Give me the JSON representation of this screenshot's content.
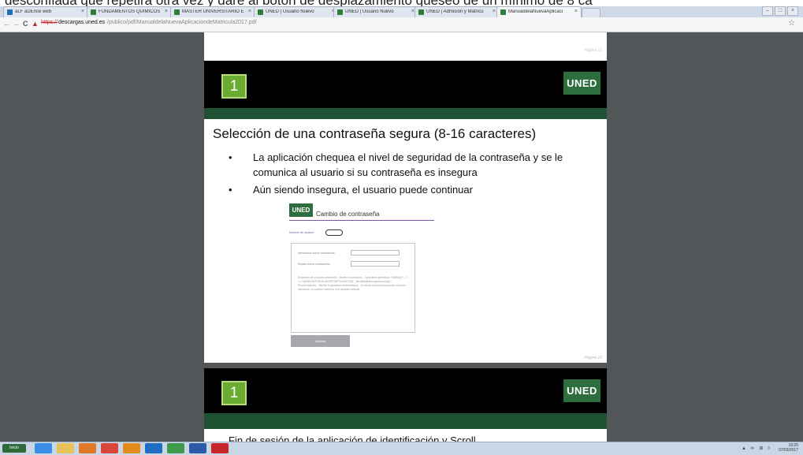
{
  "overlay_text": "desconfiada que repetirá otra vez y daré al botón de desplazamiento queseo de un mínimo de 8 ca",
  "tabs": [
    {
      "label": "aLF aDEnce web",
      "favicon": "blue"
    },
    {
      "label": "FUNDAMENTOS QUÍMICOS",
      "favicon": "green"
    },
    {
      "label": "MÁSTER UNIVERSITARIO E",
      "favicon": "green"
    },
    {
      "label": "UNED | Usuario Nuevo",
      "favicon": "green"
    },
    {
      "label": "UNED | Usuario Nuevo",
      "favicon": "green"
    },
    {
      "label": "UNED | Admisión y Matrícu",
      "favicon": "green"
    },
    {
      "label": "ManualdelaNuevaAplicaci",
      "favicon": "green"
    }
  ],
  "tab_close_glyph": "×",
  "window_buttons": [
    "–",
    "□",
    "×"
  ],
  "address": {
    "warn_icon": "▲",
    "scheme": "https://",
    "domain": "descargas.uned.es",
    "path": "/publico/pdf/ManualdelaNuevaAplicaciondeMatricula2017.pdf",
    "back": "←",
    "forward": "→",
    "reload": "C",
    "bookmark": "☆"
  },
  "pdf": {
    "page1_num": "Página 16",
    "page2_num": "Página 16",
    "slide_number": "1",
    "logo": "UNED",
    "title": "Selección de una contraseña segura (8-16 caracteres)",
    "bullets": [
      "La aplicación chequea el nivel de seguridad de la contraseña y se le comunica al usuario si su contraseña es insegura",
      "Aún siendo insegura, el usuario puede continuar"
    ],
    "bullet_glyph": "•",
    "form": {
      "logo": "UNED",
      "title": "Cambio de contraseña",
      "user_label": "Nombre de usuario:",
      "field1_label": "Introduzca nueva contraseña:",
      "field2_label": "Repita nueva contraseña:",
      "requirements": "Requisitos de la nueva contraseña: - Mínimo 8 caracteres. - Caracteres permitidos: !\"#$%&'()*+,-./:;<=>?@ABCDEFGHIJKLMNOPQRSTUVWXYZ[\\]^_`abcdefghijklmnopqrstuvwxyz{|}~ Recomendación: - Mínimo 8 caracteres alfanuméricos. - Al menos una letra mayúscula, una letra minúscula, un carácter numérico y un carácter especial.",
      "button": "Aceptar"
    },
    "next_slide_text": "Fin de sesión de la aplicación de identificación y Scroll..."
  },
  "taskbar": {
    "start_label": "Inicio",
    "apps": [
      "ie",
      "folder",
      "media",
      "chrome",
      "firefox",
      "outlook",
      "app-green",
      "word",
      "acrobat"
    ],
    "tray_icons": "▲ ⊳ ⊞ ◊",
    "time": "19:25",
    "date": "07/03/2017"
  },
  "colors": {
    "accent_green": "#6aab32",
    "uned_green": "#2e6e3e",
    "dark_band": "#000000",
    "pdf_background": "#525659"
  }
}
